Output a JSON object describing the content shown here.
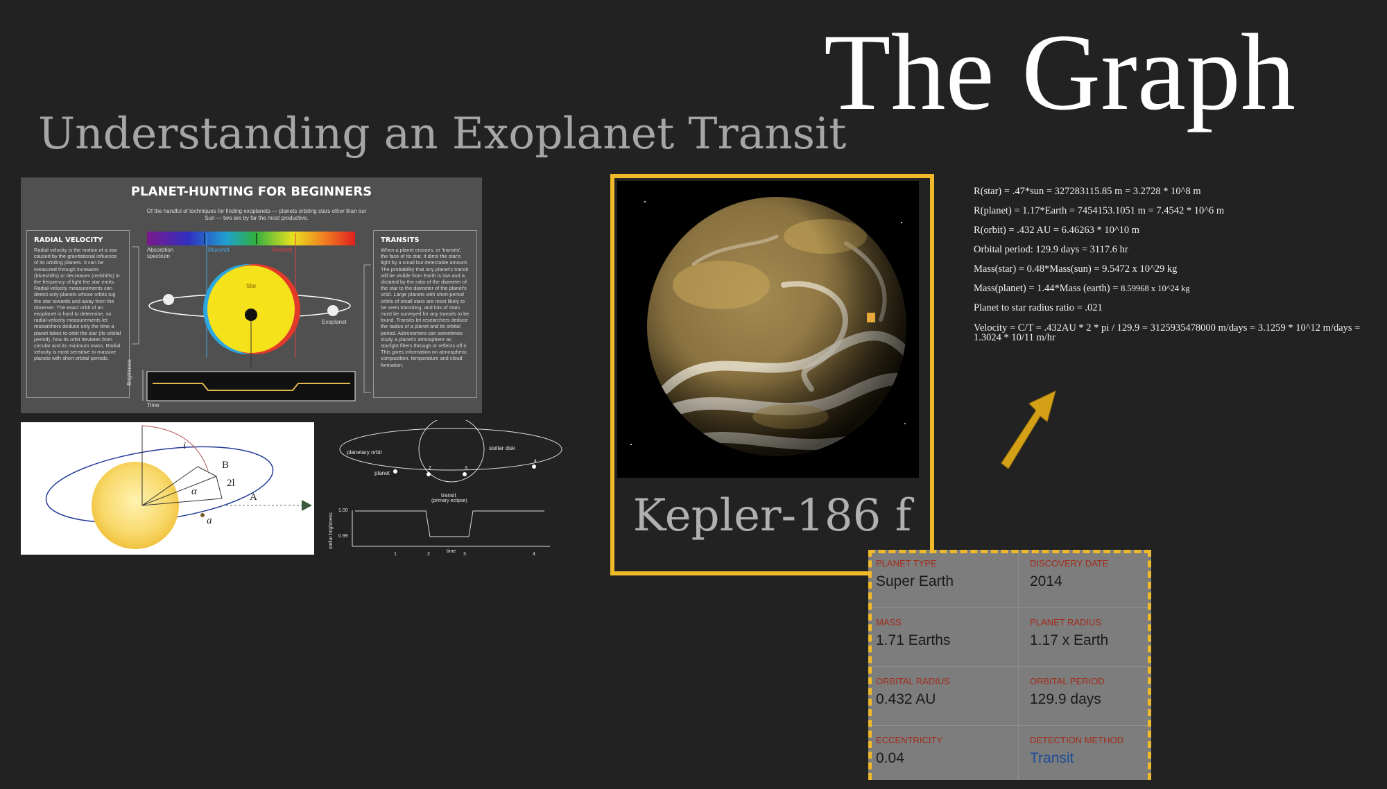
{
  "titles": {
    "main": "The Graph",
    "subtitle": "Understanding an Exoplanet Transit"
  },
  "infographic": {
    "heading": "PLANET-HUNTING FOR BEGINNERS",
    "intro": "Of the handful of techniques for finding exoplanets — planets orbiting stars other than our Sun — two are by far the most productive.",
    "radial_velocity": {
      "heading": "RADIAL VELOCITY",
      "text": "Radial velocity is the motion of a star caused by the gravitational influence of its orbiting planets. It can be measured through increases (blueshifts) or decreases (redshifts) in the frequency of light the star emits. Radial-velocity measurements can detect only planets whose orbits tug the star towards and away from the observer. The exact orbit of an exoplanet is hard to determine, so radial-velocity measurements let researchers deduce only the time a planet takes to orbit the star (its orbital period), how its orbit deviates from circular and its minimum mass. Radial velocity is most sensitive to massive planets with short orbital periods."
    },
    "transits": {
      "heading": "TRANSITS",
      "text": "When a planet crosses, or 'transits', the face of its star, it dims the star's light by a small but detectable amount. The probability that any planet's transit will be visible from Earth is low and is dictated by the ratio of the diameter of the star to the diameter of the planet's orbit. Large planets with short-period orbits of small stars are most likely to be seen transiting, and lots of stars must be surveyed for any transits to be found. Transits let researchers deduce the radius of a planet and its orbital period. Astronomers can sometimes study a planet's atmosphere as starlight filters through or reflects off it. This gives information on atmospheric composition, temperature and cloud formation."
    },
    "labels": {
      "absorption": "Absorption spectrum",
      "blueshift": "Blueshift",
      "redshift": "Redshift",
      "star": "Star",
      "exoplanet": "Exoplanet",
      "brightness": "Brightness",
      "time": "Time"
    }
  },
  "orbit_diagram": {
    "labels": {
      "i": "i",
      "B": "B",
      "two_l": "2l",
      "alpha": "α",
      "A": "A",
      "a": "a"
    }
  },
  "transit_diagram": {
    "planetary_orbit": "planetary orbit",
    "stellar_disk": "stellar disk",
    "planet": "planet",
    "transit": "transit",
    "primary_eclipse": "(primary eclipse)",
    "y_axis": "stellar brightness",
    "y_ticks": [
      "1.00",
      "0.99"
    ],
    "x_axis": "time",
    "points": [
      "1",
      "2",
      "3",
      "4"
    ]
  },
  "planet_card": {
    "name": "Kepler-186 f"
  },
  "formulas": [
    "R(star) = .47*sun = 327283115.85 m = 3.2728 * 10^8 m",
    "R(planet) = 1.17*Earth = 7454153.1051 m = 7.4542 * 10^6 m",
    "R(orbit) = .432 AU = 6.46263 * 10^10 m",
    "Orbital period: 129.9 days = 3117.6 hr",
    "Mass(star) = 0.48*Mass(sun) = 9.5472 x 10^29 kg",
    "Mass(planet) = 1.44*Mass (earth) = ",
    "8.59968 x 10^24 kg",
    "Planet to star radius ratio = .021",
    "Velocity = C/T = .432AU * 2 * pi / 129.9 = 3125935478000 m/days = 3.1259 * 10^12 m/days = 1.3024 * 10/11 m/hr"
  ],
  "data_table": {
    "cells": [
      {
        "key": "PLANET TYPE",
        "value": "Super Earth"
      },
      {
        "key": "DISCOVERY DATE",
        "value": "2014"
      },
      {
        "key": "MASS",
        "value": "1.71 Earths"
      },
      {
        "key": "PLANET RADIUS",
        "value": "1.17 x Earth"
      },
      {
        "key": "ORBITAL RADIUS",
        "value": "0.432 AU"
      },
      {
        "key": "ORBITAL PERIOD",
        "value": "129.9 days"
      },
      {
        "key": "ECCENTRICITY",
        "value": "0.04"
      },
      {
        "key": "DETECTION METHOD",
        "value": "Transit"
      }
    ]
  },
  "colors": {
    "background": "#222222",
    "accent_gold": "#f0b92a",
    "key_red": "#a02c1a",
    "link_blue": "#1a4b9a"
  }
}
